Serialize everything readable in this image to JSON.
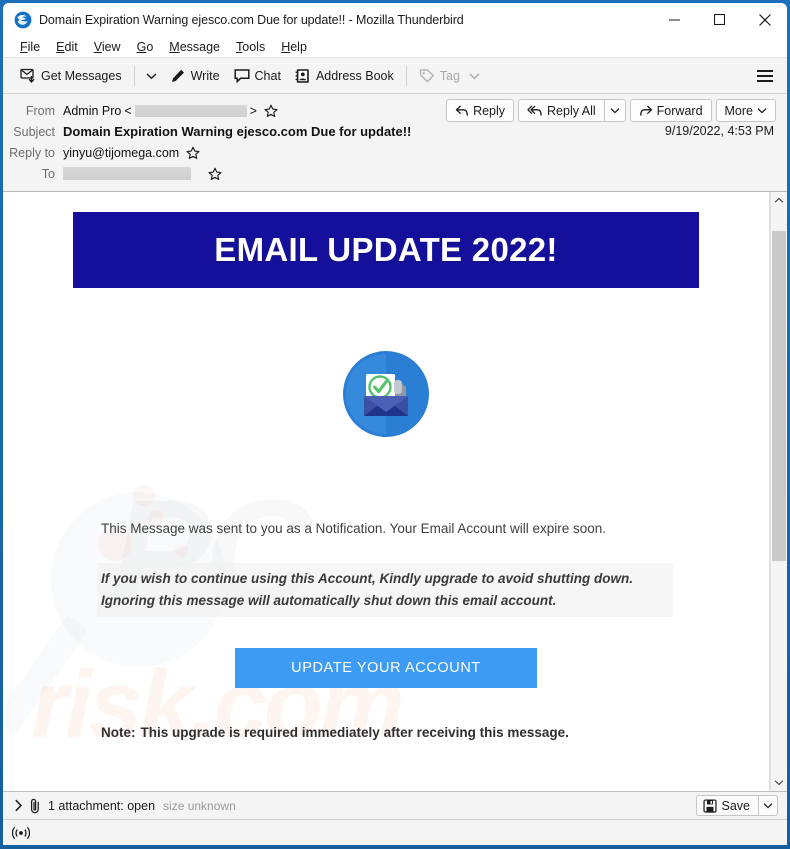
{
  "window": {
    "title": "Domain Expiration Warning ejesco.com Due for update!! - Mozilla Thunderbird",
    "app_icon": "thunderbird-icon",
    "controls": {
      "minimize": "minimize-icon",
      "maximize": "maximize-icon",
      "close": "close-icon"
    },
    "frame_color": "#1565b0"
  },
  "menu_bar": {
    "items": [
      {
        "label": "File",
        "accel": "F"
      },
      {
        "label": "Edit",
        "accel": "E"
      },
      {
        "label": "View",
        "accel": "V"
      },
      {
        "label": "Go",
        "accel": "G"
      },
      {
        "label": "Message",
        "accel": "M"
      },
      {
        "label": "Tools",
        "accel": "T"
      },
      {
        "label": "Help",
        "accel": "H"
      }
    ]
  },
  "toolbar": {
    "get_messages_label": "Get Messages",
    "get_messages_caret": "chevron-down-icon",
    "write_label": "Write",
    "chat_label": "Chat",
    "address_book_label": "Address Book",
    "tag_label": "Tag",
    "tag_caret": "chevron-down-icon",
    "hamburger": "app-menu-icon"
  },
  "message_header": {
    "from_label": "From",
    "from_name": "Admin Pro",
    "from_open_bracket": "<",
    "from_close_bracket": ">",
    "from_address_redacted": true,
    "subject_label": "Subject",
    "subject_value": "Domain Expiration Warning ejesco.com Due for update!!",
    "reply_to_label": "Reply to",
    "reply_to_value": "yinyu@tijomega.com",
    "to_label": "To",
    "to_redacted": true,
    "date": "9/19/2022, 4:53 PM",
    "star_icon": "star-icon",
    "actions": {
      "reply": "Reply",
      "reply_all": "Reply All",
      "reply_all_caret": "chevron-down-icon",
      "forward": "Forward",
      "more": "More",
      "more_caret": "chevron-down-icon"
    }
  },
  "email": {
    "banner_title": "EMAIL UPDATE 2022!",
    "banner_color": "#15109b",
    "hero_icon": "mail-check-icon",
    "notification_text": "This Message was sent to you as a Notification. Your Email Account will expire soon.",
    "warning_line_1": "If you wish to continue using this Account, Kindly upgrade to avoid shutting down.",
    "warning_line_2": "Ignoring this message will automatically shut down this email account.",
    "cta_label": "UPDATE YOUR ACCOUNT",
    "cta_color": "#3e9bf4",
    "note_prefix": "Note:",
    "note_text": "This upgrade is required immediately after receiving this message.",
    "watermark_primary": "PC",
    "watermark_secondary": "risk.com"
  },
  "scrollbar": {
    "up_arrow": "chevron-up-icon",
    "down_arrow": "chevron-down-icon",
    "thumb": "scrollbar-thumb"
  },
  "attachment_bar": {
    "expand_icon": "chevron-right-icon",
    "paperclip_icon": "paperclip-icon",
    "label": "1 attachment: open",
    "size": "size unknown",
    "save_label": "Save",
    "save_icon": "save-disk-icon",
    "save_caret": "chevron-down-icon"
  },
  "status_bar": {
    "icon": "broadcast-icon"
  }
}
